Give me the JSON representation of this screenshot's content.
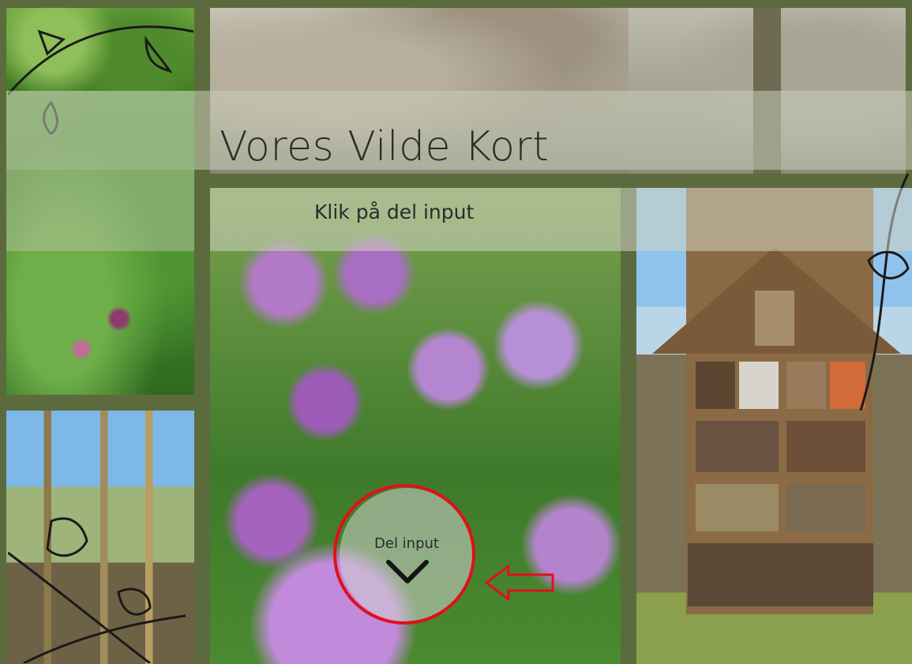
{
  "page": {
    "title": "Vores Vilde Kort",
    "subtitle": "Klik på del input"
  },
  "share_button": {
    "label": "Del input",
    "icon": "chevron-down-icon"
  },
  "annotation": {
    "color": "#e0101a"
  },
  "colors": {
    "frame": "#5b6b3e",
    "text": "#2b2b2b"
  }
}
